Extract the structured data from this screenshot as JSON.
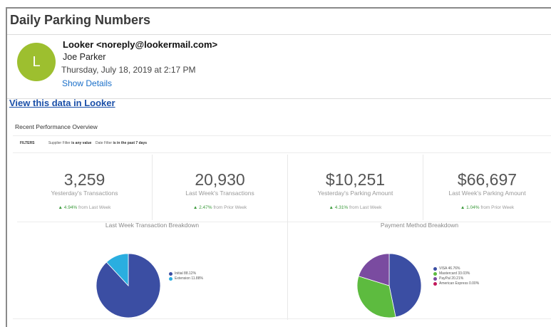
{
  "email": {
    "subject": "Daily Parking Numbers",
    "avatar_letter": "L",
    "sender": "Looker <noreply@lookermail.com>",
    "recipient": "Joe Parker",
    "date": "Thursday, July 18, 2019 at 2:17 PM",
    "show_details": "Show Details",
    "view_link": "View this data in Looker"
  },
  "dashboard": {
    "title": "Recent Performance Overview",
    "filters_label": "FILTERS",
    "filters": [
      {
        "name": "Supplier Filter",
        "condition": "is any value"
      },
      {
        "name": "Date Filter",
        "condition": "is in the past 7 days"
      }
    ],
    "tiles": [
      {
        "value": "3,259",
        "label": "Yesterday's Transactions",
        "change": "▲ 4.94%",
        "compare": "from Last Week"
      },
      {
        "value": "20,930",
        "label": "Last Week's Transactions",
        "change": "▲ 2.47%",
        "compare": "from Prior Week"
      },
      {
        "value": "$10,251",
        "label": "Yesterday's Parking Amount",
        "change": "▲ 4.31%",
        "compare": "from Last Week"
      },
      {
        "value": "$66,697",
        "label": "Last Week's Parking Amount",
        "change": "▲ 1.04%",
        "compare": "from Prior Week"
      }
    ]
  },
  "colors": {
    "avatar": "#9dbf2f",
    "link": "#1a4fa8",
    "positive_change": "#3a9a3a"
  },
  "chart_data": [
    {
      "type": "pie",
      "title": "Last Week Transaction Breakdown",
      "legend_position": "right",
      "slices": [
        {
          "label": "Initial 88.12%",
          "value": 88.12,
          "color": "#3b4ea3"
        },
        {
          "label": "Extension 11.88%",
          "value": 11.88,
          "color": "#2aaee0"
        }
      ]
    },
    {
      "type": "pie",
      "title": "Payment Method Breakdown",
      "legend_position": "right",
      "slices": [
        {
          "label": "VISA 46.76%",
          "value": 46.76,
          "color": "#3b4ea3"
        },
        {
          "label": "Mastercard 33.03%",
          "value": 33.03,
          "color": "#5dbb3f"
        },
        {
          "label": "PayPal 20.21%",
          "value": 20.21,
          "color": "#7a4ba0"
        },
        {
          "label": "American Express 0.00%",
          "value": 0.0,
          "color": "#c2185b"
        }
      ]
    }
  ]
}
